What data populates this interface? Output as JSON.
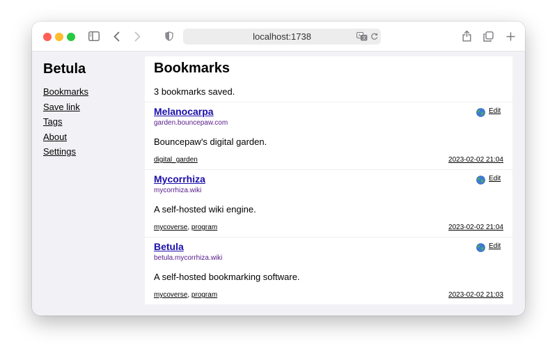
{
  "browser": {
    "url": "localhost:1738",
    "icons": [
      "sidebar-toggle-icon",
      "back-icon",
      "forward-icon",
      "privacy-shield-icon",
      "translate-icon",
      "reload-icon",
      "share-icon",
      "tabs-overview-icon",
      "new-tab-icon"
    ]
  },
  "sidebar": {
    "site_title": "Betula",
    "items": [
      {
        "label": "Bookmarks"
      },
      {
        "label": "Save link"
      },
      {
        "label": "Tags"
      },
      {
        "label": "About"
      },
      {
        "label": "Settings"
      }
    ]
  },
  "main": {
    "heading": "Bookmarks",
    "count_text": "3 bookmarks saved.",
    "bookmarks": [
      {
        "title": "Melanocarpa",
        "domain": "garden.bouncepaw.com",
        "description": "Bouncepaw's digital garden.",
        "tags": [
          "digital_garden"
        ],
        "tag_sep": "",
        "date": "2023-02-02 21:04",
        "edit_label": "Edit"
      },
      {
        "title": "Mycorrhiza",
        "domain": "mycorrhiza.wiki",
        "description": "A self-hosted wiki engine.",
        "tags": [
          "mycoverse",
          "program"
        ],
        "tag_sep": ", ",
        "date": "2023-02-02 21:04",
        "edit_label": "Edit"
      },
      {
        "title": "Betula",
        "domain": "betula.mycorrhiza.wiki",
        "description": "A self-hosted bookmarking software.",
        "tags": [
          "mycoverse",
          "program"
        ],
        "tag_sep": ", ",
        "date": "2023-02-02 21:03",
        "edit_label": "Edit"
      }
    ]
  }
}
